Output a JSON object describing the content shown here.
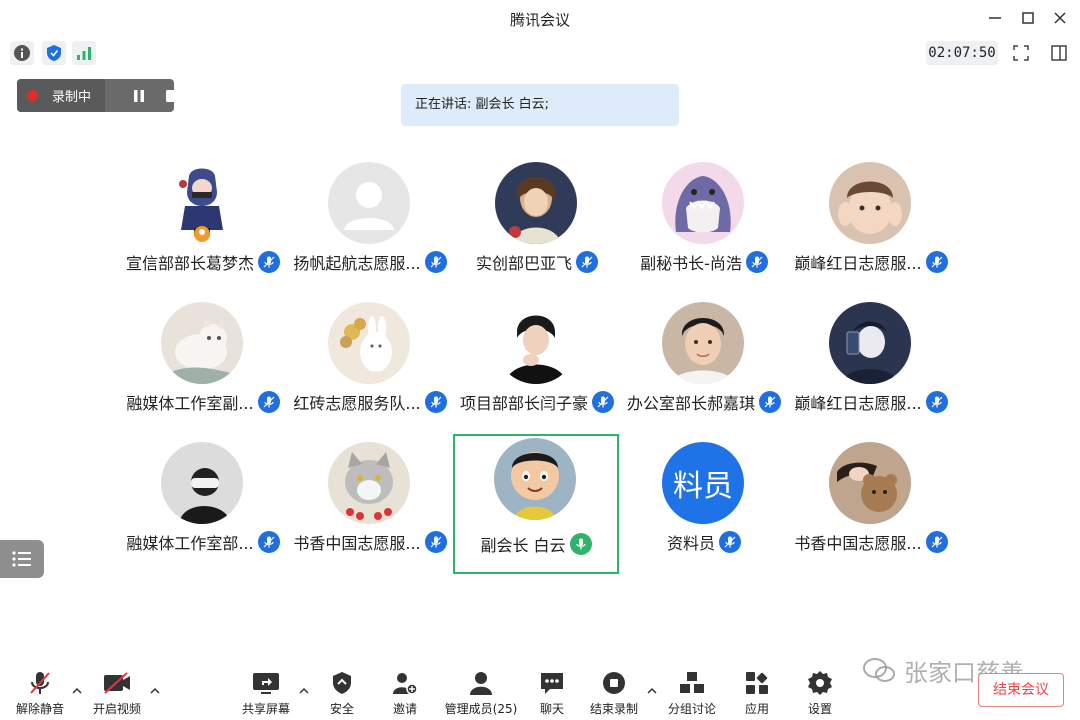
{
  "window": {
    "title": "腾讯会议"
  },
  "toolbar": {
    "timer": "02:07:50"
  },
  "recording": {
    "label": "录制中"
  },
  "speaking": {
    "text": "正在讲话: 副会长 白云;"
  },
  "participants": [
    {
      "name": "宣信部部长葛梦杰",
      "avatar": "cartoon-hooded-figure",
      "avatar_bg": "#ffffff"
    },
    {
      "name": "扬帆起航志愿服...",
      "avatar": "default-person",
      "avatar_bg": "#e6e6e6"
    },
    {
      "name": "实创部巴亚飞",
      "avatar": "painting-portrait",
      "avatar_bg": "#3a4a6a"
    },
    {
      "name": "副秘书长-尚浩",
      "avatar": "cartoon-shark",
      "avatar_bg": "#f4d9ea"
    },
    {
      "name": "巅峰红日志愿服...",
      "avatar": "child-photo",
      "avatar_bg": "#d9c3b0"
    },
    {
      "name": "融媒体工作室副...",
      "avatar": "cat-photo",
      "avatar_bg": "#e8e2da"
    },
    {
      "name": "红砖志愿服务队...",
      "avatar": "bunny-with-flowers",
      "avatar_bg": "#f0e8dc"
    },
    {
      "name": "项目部部长闫子豪",
      "avatar": "boy-photo",
      "avatar_bg": "#2a2a2a"
    },
    {
      "name": "办公室部长郝嘉琪",
      "avatar": "boy-selfie",
      "avatar_bg": "#c9b6a4"
    },
    {
      "name": "巅峰红日志愿服...",
      "avatar": "anime-boy",
      "avatar_bg": "#2c3550"
    },
    {
      "name": "融媒体工作室部...",
      "avatar": "vr-headset-figure",
      "avatar_bg": "#dcdcdc"
    },
    {
      "name": "书香中国志愿服...",
      "avatar": "cat-flowers",
      "avatar_bg": "#e7e1d6"
    },
    {
      "name": "副会长 白云",
      "avatar": "cartoon-big-head-boy",
      "avatar_bg": "#9db4c4",
      "speaking": true
    },
    {
      "name": "资料员",
      "avatar": "text-avatar",
      "avatar_text": "料员",
      "avatar_bg": "#1e73e6"
    },
    {
      "name": "书香中国志愿服...",
      "avatar": "teddy-bear",
      "avatar_bg": "#bfa48e"
    }
  ],
  "bottombar": {
    "unmute": "解除静音",
    "video": "开启视频",
    "share": "共享屏幕",
    "security": "安全",
    "invite": "邀请",
    "members": "管理成员(25)",
    "chat": "聊天",
    "end_recording": "结束录制",
    "breakout": "分组讨论",
    "apps": "应用",
    "settings": "设置",
    "end_meeting": "结束会议"
  },
  "watermark": {
    "text": "张家口慈善"
  },
  "colors": {
    "accent": "#1f6fe0",
    "speaking": "#2fb36b",
    "danger": "#e44444"
  }
}
